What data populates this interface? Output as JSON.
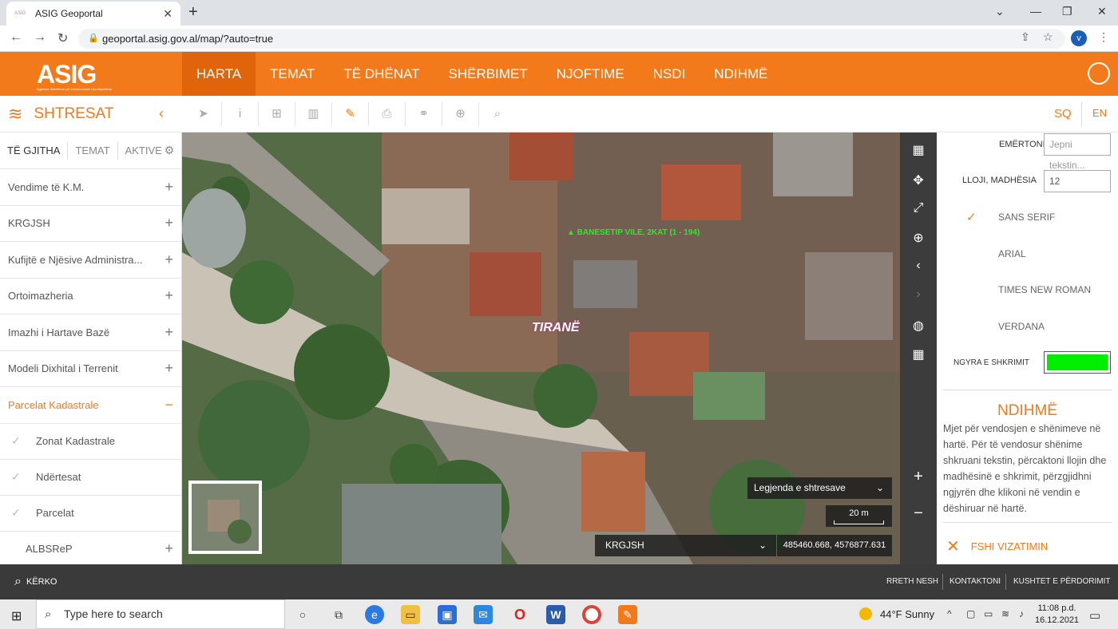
{
  "browser": {
    "tab_title": "ASIG Geoportal",
    "tab_favicon": "ASIG",
    "url": "geoportal.asig.gov.al/map/?auto=true",
    "profile_initial": "v"
  },
  "header": {
    "logo": "ASIG",
    "logo_subtitle": "Agjencia Shtetërore për Informacionin Gjeohapësinor",
    "nav": [
      "HARTA",
      "TEMAT",
      "TË DHËNAT",
      "SHËRBIMET",
      "NJOFTIME",
      "NSDI",
      "NDIHMË"
    ],
    "active_nav": "HARTA"
  },
  "toolbar": {
    "panel_title": "SHTRESAT",
    "lang_sq": "SQ",
    "lang_en": "EN"
  },
  "sidebar": {
    "tabs": [
      "TË GJITHA",
      "TEMAT",
      "AKTIVE"
    ],
    "layers": [
      {
        "label": "Vendime të K.M."
      },
      {
        "label": "KRGJSH"
      },
      {
        "label": "Kufijtë e Njësive Administra..."
      },
      {
        "label": "Ortoimazheria"
      },
      {
        "label": "Imazhi i Hartave Bazë"
      },
      {
        "label": "Modeli Dixhital i Terrenit"
      },
      {
        "label": "Parcelat Kadastrale"
      }
    ],
    "sublayers": [
      "Zonat Kadastrale",
      "Ndërtesat",
      "Parcelat"
    ],
    "last_layer": "ALBSReP"
  },
  "map": {
    "annotation": "▲ BANESETIP VILE, 2KAT (1 - 194)",
    "logo_text": "TIRANË",
    "legend_label": "Legjenda e shtresave",
    "scale": "20 m",
    "basemap": "KRGJSH",
    "coordinates": "485460.668, 4576877.631"
  },
  "right_panel": {
    "name_label": "EMËRTONI",
    "name_placeholder": "Jepni tekstin...",
    "size_label": "LLOJI, MADHËSIA",
    "size_value": "12",
    "fonts": [
      "SANS SERIF",
      "ARIAL",
      "TIMES NEW ROMAN",
      "VERDANA"
    ],
    "selected_font": "SANS SERIF",
    "color_label": "NGYRA E SHKRIMIT",
    "text_color": "#00ee00",
    "help_title": "NDIHMË",
    "help_text": "Mjet për vendosjen e shënimeve në hartë. Për të vendosur shënime shkruani tekstin, përcaktoni llojin dhe madhësinë e shkrimit, përzgjidhni ngjyrën dhe klikoni në vendin e dëshiruar në hartë.",
    "clear_label": "FSHI VIZATIMIN"
  },
  "footer": {
    "search_label": "KËRKO",
    "links": [
      "RRETH NESH",
      "KONTAKTONI",
      "KUSHTET E PËRDORIMIT"
    ]
  },
  "taskbar": {
    "search_placeholder": "Type here to search",
    "weather": "44°F  Sunny",
    "time": "11:08 p.d.",
    "date": "16.12.2021"
  },
  "colors": {
    "brand_orange": "#f27a1a",
    "footer": "#3a3a3a"
  }
}
